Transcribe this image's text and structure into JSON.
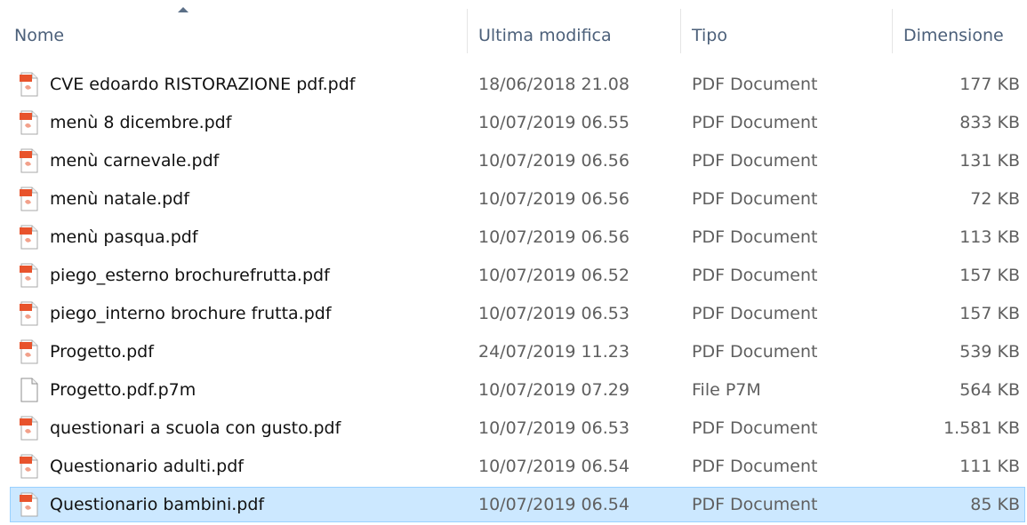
{
  "columns": {
    "name": "Nome",
    "modified": "Ultima modifica",
    "type": "Tipo",
    "size": "Dimensione"
  },
  "files": [
    {
      "name": "CVE edoardo RISTORAZIONE pdf.pdf",
      "modified": "18/06/2018 21.08",
      "type": "PDF Document",
      "size": "177 KB",
      "icon": "pdf-file-icon"
    },
    {
      "name": "menù 8 dicembre.pdf",
      "modified": "10/07/2019 06.55",
      "type": "PDF Document",
      "size": "833 KB",
      "icon": "pdf-file-icon"
    },
    {
      "name": "menù carnevale.pdf",
      "modified": "10/07/2019 06.56",
      "type": "PDF Document",
      "size": "131 KB",
      "icon": "pdf-file-icon"
    },
    {
      "name": "menù natale.pdf",
      "modified": "10/07/2019 06.56",
      "type": "PDF Document",
      "size": "72 KB",
      "icon": "pdf-file-icon"
    },
    {
      "name": "menù pasqua.pdf",
      "modified": "10/07/2019 06.56",
      "type": "PDF Document",
      "size": "113 KB",
      "icon": "pdf-file-icon"
    },
    {
      "name": "piego_esterno brochurefrutta.pdf",
      "modified": "10/07/2019 06.52",
      "type": "PDF Document",
      "size": "157 KB",
      "icon": "pdf-file-icon"
    },
    {
      "name": "piego_interno brochure frutta.pdf",
      "modified": "10/07/2019 06.53",
      "type": "PDF Document",
      "size": "157 KB",
      "icon": "pdf-file-icon"
    },
    {
      "name": "Progetto.pdf",
      "modified": "24/07/2019 11.23",
      "type": "PDF Document",
      "size": "539 KB",
      "icon": "pdf-file-icon"
    },
    {
      "name": "Progetto.pdf.p7m",
      "modified": "10/07/2019 07.29",
      "type": "File P7M",
      "size": "564 KB",
      "icon": "blank-file-icon"
    },
    {
      "name": "questionari a scuola con gusto.pdf",
      "modified": "10/07/2019 06.53",
      "type": "PDF Document",
      "size": "1.581 KB",
      "icon": "pdf-file-icon"
    },
    {
      "name": "Questionario adulti.pdf",
      "modified": "10/07/2019 06.54",
      "type": "PDF Document",
      "size": "111 KB",
      "icon": "pdf-file-icon"
    },
    {
      "name": "Questionario bambini.pdf",
      "modified": "10/07/2019 06.54",
      "type": "PDF Document",
      "size": "85 KB",
      "icon": "pdf-file-icon",
      "selected": true
    }
  ],
  "colors": {
    "header_text": "#4c607a",
    "selection_bg": "#cce8ff",
    "selection_border": "#99d1ff",
    "pdf_badge": "#e8532c"
  }
}
